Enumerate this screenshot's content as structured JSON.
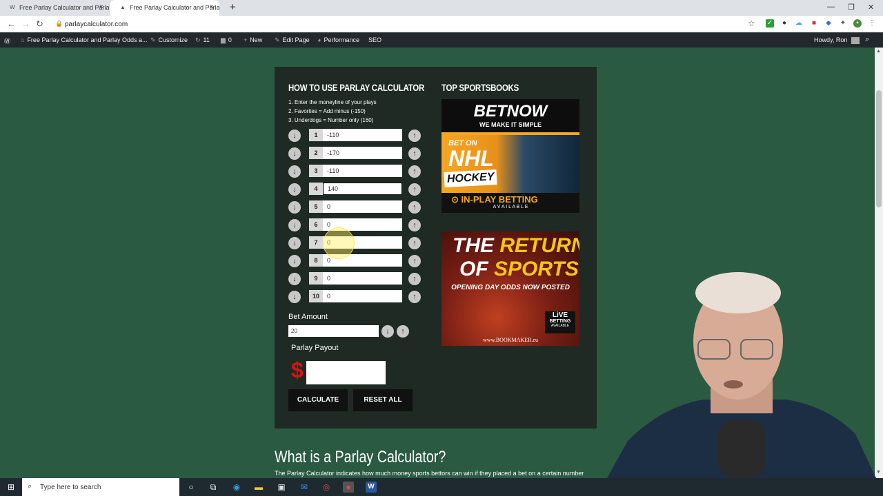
{
  "browser": {
    "tabs": [
      {
        "title": "Free Parlay Calculator and Parlay",
        "close": "×"
      },
      {
        "title": "Free Parlay Calculator and Parlay",
        "close": "×"
      }
    ],
    "new_tab": "+",
    "window_controls": [
      "—",
      "❐",
      "✕"
    ],
    "url": "parlaycalculator.com"
  },
  "wpbar": {
    "site_title": "Free Parlay Calculator and Parlay Odds a...",
    "customize": "Customize",
    "updates": "11",
    "comments": "0",
    "new": "New",
    "edit_page": "Edit Page",
    "performance": "Performance",
    "seo": "SEO",
    "greeting": "Howdy, Ron"
  },
  "calculator": {
    "title": "HOW TO USE PARLAY CALCULATOR",
    "instructions": [
      "1. Enter the moneyline of your plays",
      "2. Favorites = Add minus (-150)",
      "3. Underdogs = Number only (160)"
    ],
    "rows": [
      {
        "num": "1",
        "value": "-110"
      },
      {
        "num": "2",
        "value": "-170"
      },
      {
        "num": "3",
        "value": "-110"
      },
      {
        "num": "4",
        "value": "140"
      },
      {
        "num": "5",
        "value": "0"
      },
      {
        "num": "6",
        "value": "0"
      },
      {
        "num": "7",
        "value": "0"
      },
      {
        "num": "8",
        "value": "0"
      },
      {
        "num": "9",
        "value": "0"
      },
      {
        "num": "10",
        "value": "0"
      }
    ],
    "bet_amount_label": "Bet Amount",
    "bet_amount": "20",
    "payout_label": "Parlay Payout",
    "currency": "$",
    "payout_value": "",
    "calculate": "CALCULATE",
    "reset_all": "RESET ALL"
  },
  "sportsbooks": {
    "title": "TOP SPORTSBOOKS",
    "ad1": {
      "brand": "BETNOW",
      "tagline": "WE MAKE IT SIMPLE",
      "bet_on": "BET ON",
      "league": "NHL",
      "sport": "HOCKEY",
      "cta": "IN-PLAY BETTING",
      "cta_sub": "A V A I L A B L E"
    },
    "ad2": {
      "line1_a": "THE",
      "line1_b": "RETURN",
      "line2_a": "OF",
      "line2_b": "SPORTS",
      "sub": "OPENING DAY ODDS NOW POSTED",
      "badge1": "LiVE",
      "badge2": "BETTING",
      "badge3": "AVAILABLE",
      "site": "www.BOOKMAKER.eu"
    }
  },
  "article": {
    "title": "What is a Parlay Calculator?",
    "text": "The Parlay Calculator indicates how much money sports bettors can win if they placed a bet on a certain number"
  },
  "taskbar": {
    "search_placeholder": "Type here to search"
  },
  "colors": {
    "page_bg": "#2b5a43",
    "panel_bg": "#1f2a24",
    "accent_orange": "#f5a623",
    "dollar_red": "#dd1111"
  }
}
